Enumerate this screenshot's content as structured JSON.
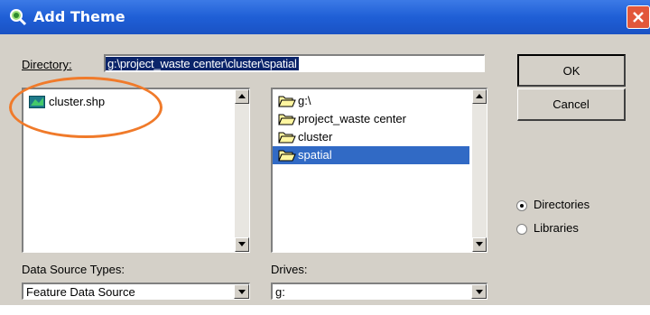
{
  "window": {
    "title": "Add Theme"
  },
  "directory": {
    "label": "Directory:",
    "value": "g:\\project_waste center\\cluster\\spatial"
  },
  "buttons": {
    "ok": "OK",
    "cancel": "Cancel"
  },
  "file_list": {
    "items": [
      {
        "label": "cluster.shp",
        "icon": "shapefile-icon"
      }
    ]
  },
  "folder_list": {
    "items": [
      {
        "label": "g:\\",
        "icon": "open-folder-icon",
        "selected": false
      },
      {
        "label": "project_waste center",
        "icon": "open-folder-icon",
        "selected": false
      },
      {
        "label": "cluster",
        "icon": "open-folder-icon",
        "selected": false
      },
      {
        "label": "spatial",
        "icon": "open-folder-icon",
        "selected": true
      }
    ]
  },
  "radios": {
    "directories": {
      "label": "Directories",
      "checked": true
    },
    "libraries": {
      "label": "Libraries",
      "checked": false
    }
  },
  "data_source": {
    "label": "Data Source Types:",
    "value": "Feature Data Source"
  },
  "drives": {
    "label": "Drives:",
    "value": "g:"
  },
  "colors": {
    "titlebar": "#1f5fd6",
    "selection": "#316ac5",
    "highlight_circle": "#f07a2a"
  }
}
